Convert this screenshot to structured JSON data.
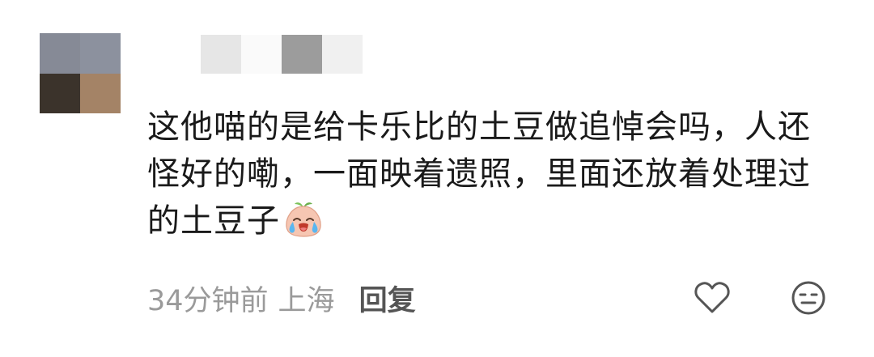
{
  "comment": {
    "avatar_colors": [
      "#868a96",
      "#8c919e",
      "#3b332b",
      "#a48366"
    ],
    "username_blur_colors": [
      "#e6e6e6",
      "#fafafa",
      "#9c9c9c",
      "#f0f0f0"
    ],
    "text": "这他喵的是给卡乐比的土豆做追悼会吗，人还怪好的嘞，一面映着遗照，里面还放着处理过的土豆子",
    "emoji": "crying-face-emoji",
    "time": "34分钟前",
    "location": "上海",
    "reply_label": "回复",
    "like_icon": "heart-outline-icon",
    "dislike_icon": "unamused-face-icon"
  }
}
